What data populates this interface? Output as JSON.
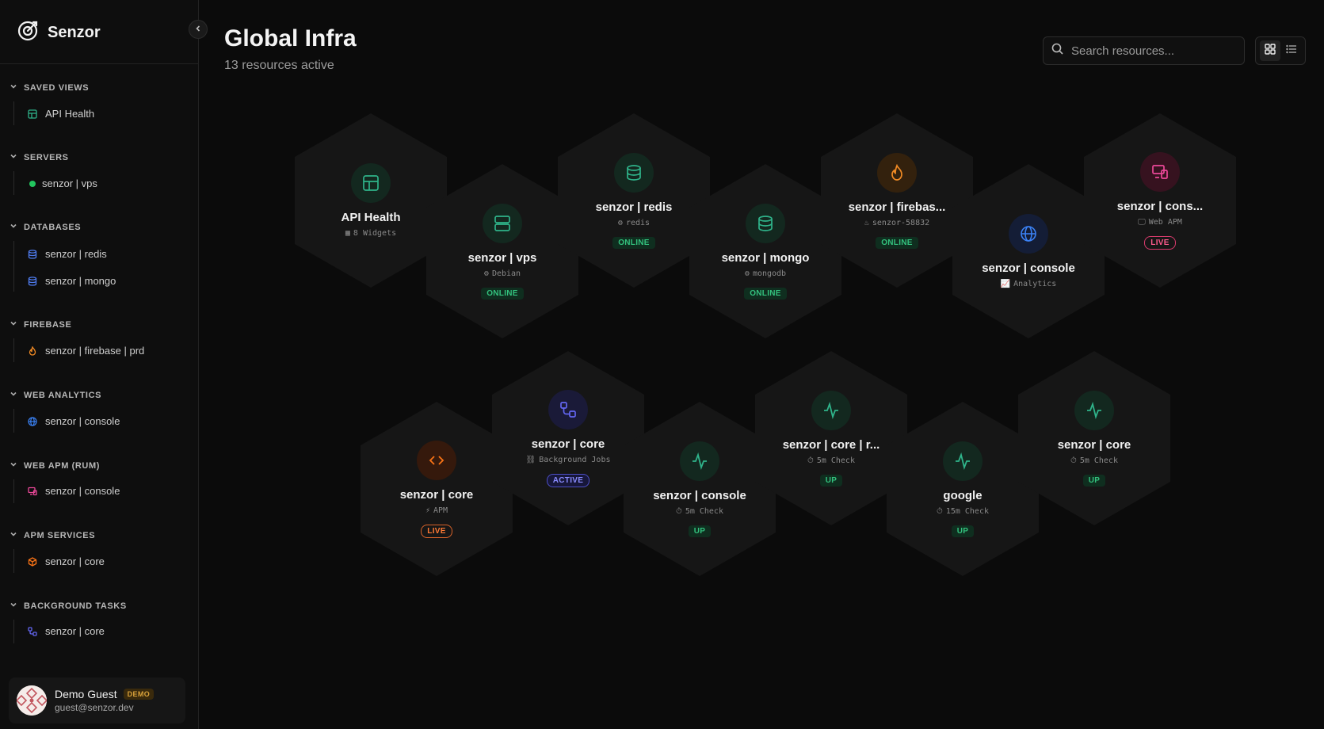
{
  "brand": {
    "name": "Senzor"
  },
  "header": {
    "title": "Global Infra",
    "subtitle": "13 resources active",
    "search_placeholder": "Search resources..."
  },
  "sidebar": {
    "sections": [
      {
        "title": "SAVED VIEWS",
        "items": [
          {
            "label": "API Health",
            "icon": "layout-icon",
            "color": "#2fb38a"
          }
        ]
      },
      {
        "title": "SERVERS",
        "items": [
          {
            "label": "senzor | vps",
            "icon": "status-dot",
            "color": "#22c55e"
          }
        ]
      },
      {
        "title": "DATABASES",
        "items": [
          {
            "label": "senzor | redis",
            "icon": "database-icon",
            "color": "#4f7cf0"
          },
          {
            "label": "senzor | mongo",
            "icon": "database-icon",
            "color": "#4f7cf0"
          }
        ]
      },
      {
        "title": "FIREBASE",
        "items": [
          {
            "label": "senzor | firebase | prd",
            "icon": "flame-icon",
            "color": "#f08a24"
          }
        ]
      },
      {
        "title": "WEB ANALYTICS",
        "items": [
          {
            "label": "senzor | console",
            "icon": "globe-icon",
            "color": "#3b82f6"
          }
        ]
      },
      {
        "title": "WEB APM (RUM)",
        "items": [
          {
            "label": "senzor | console",
            "icon": "monitor-icon",
            "color": "#ec4899"
          }
        ]
      },
      {
        "title": "APM SERVICES",
        "items": [
          {
            "label": "senzor | core",
            "icon": "box-icon",
            "color": "#f97316"
          }
        ]
      },
      {
        "title": "BACKGROUND TASKS",
        "items": [
          {
            "label": "senzor | core",
            "icon": "workflow-icon",
            "color": "#6366f1"
          }
        ]
      }
    ]
  },
  "user": {
    "name": "Demo Guest",
    "badge": "DEMO",
    "email": "guest@senzor.dev"
  },
  "resources": [
    {
      "name": "API Health",
      "meta": "8 Widgets",
      "badge": "",
      "icon": "layout-icon",
      "accent": "#2fb38a"
    },
    {
      "name": "senzor | vps",
      "meta": "Debian",
      "badge": "ONLINE",
      "icon": "server-icon",
      "accent": "#2fb38a"
    },
    {
      "name": "senzor | redis",
      "meta": "redis",
      "badge": "ONLINE",
      "icon": "database-icon",
      "accent": "#2fb38a"
    },
    {
      "name": "senzor | mongo",
      "meta": "mongodb",
      "badge": "ONLINE",
      "icon": "database-icon",
      "accent": "#2fb38a"
    },
    {
      "name": "senzor | firebas...",
      "meta": "senzor-58832",
      "badge": "ONLINE",
      "icon": "flame-icon",
      "accent": "#f08a24"
    },
    {
      "name": "senzor | console",
      "meta": "Analytics",
      "badge": "",
      "icon": "globe-icon",
      "accent": "#3b82f6"
    },
    {
      "name": "senzor | cons...",
      "meta": "Web APM",
      "badge": "LIVE",
      "icon": "monitor-icon",
      "accent": "#ec4899"
    },
    {
      "name": "senzor | core",
      "meta": "APM",
      "badge": "LIVE",
      "icon": "code-icon",
      "accent": "#f97316"
    },
    {
      "name": "senzor | core",
      "meta": "Background Jobs",
      "badge": "ACTIVE",
      "icon": "workflow-icon",
      "accent": "#6366f1"
    },
    {
      "name": "senzor | console",
      "meta": "5m Check",
      "badge": "UP",
      "icon": "activity-icon",
      "accent": "#2fb38a"
    },
    {
      "name": "senzor | core | r...",
      "meta": "5m Check",
      "badge": "UP",
      "icon": "activity-icon",
      "accent": "#2fb38a"
    },
    {
      "name": "google",
      "meta": "15m Check",
      "badge": "UP",
      "icon": "activity-icon",
      "accent": "#2fb38a"
    },
    {
      "name": "senzor | core",
      "meta": "5m Check",
      "badge": "UP",
      "icon": "activity-icon",
      "accent": "#2fb38a"
    }
  ]
}
